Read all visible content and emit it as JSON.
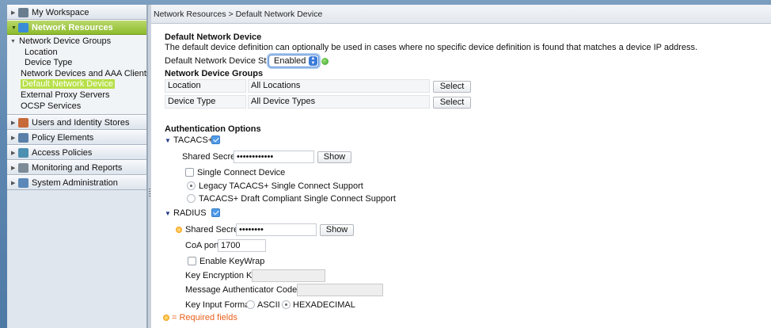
{
  "sidebar": {
    "sections": [
      {
        "label": "My Workspace",
        "icon": "workspace-icon",
        "color": "#6a7d8f"
      },
      {
        "label": "Network Resources",
        "icon": "network-icon",
        "color": "#3a8bd8",
        "active": true
      },
      {
        "label": "Users and Identity Stores",
        "icon": "users-icon",
        "color": "#c66a3a"
      },
      {
        "label": "Policy Elements",
        "icon": "policy-elements-icon",
        "color": "#5a7fa8"
      },
      {
        "label": "Access Policies",
        "icon": "access-policies-icon",
        "color": "#4d8fb0"
      },
      {
        "label": "Monitoring and Reports",
        "icon": "monitoring-icon",
        "color": "#7d8a97"
      },
      {
        "label": "System Administration",
        "icon": "system-admin-icon",
        "color": "#5b88b8"
      }
    ],
    "network_resources_items": {
      "group": "Network Device Groups",
      "group_children": [
        "Location",
        "Device Type"
      ],
      "others": [
        "Network Devices and AAA Clients",
        "Default Network Device",
        "External Proxy Servers",
        "OCSP Services"
      ],
      "selected": "Default Network Device"
    }
  },
  "breadcrumb": "Network Resources > Default Network Device",
  "form": {
    "title": "Default Network Device",
    "description": "The default device definition can optionally be used in cases where no specific device definition is found that matches a device IP address.",
    "status_label": "Default Network Device Status:",
    "status_value": "Enabled",
    "ndg_title": "Network Device Groups",
    "ndg_rows": [
      {
        "name": "Location",
        "value": "All Locations",
        "button": "Select"
      },
      {
        "name": "Device Type",
        "value": "All Device Types",
        "button": "Select"
      }
    ],
    "auth_title": "Authentication Options",
    "tacacs": {
      "label": "TACACS+",
      "checked": true,
      "shared_secret_label": "Shared Secret:",
      "shared_secret_value": "••••••••••••",
      "show_button": "Show",
      "single_connect_label": "Single Connect Device",
      "legacy_label": "Legacy TACACS+ Single Connect Support",
      "draft_label": "TACACS+ Draft Compliant Single Connect Support"
    },
    "radius": {
      "label": "RADIUS",
      "checked": true,
      "shared_secret_label": "Shared Secret:",
      "shared_secret_value": "••••••••",
      "show_button": "Show",
      "coa_label": "CoA port:",
      "coa_value": "1700",
      "keywrap_label": "Enable KeyWrap",
      "kek_label": "Key Encryption Key:",
      "mack_label": "Message Authenticator Code Key:",
      "key_format_label": "Key Input Format",
      "ascii_label": "ASCII",
      "hex_label": "HEXADECIMAL",
      "key_format_selected": "HEXADECIMAL"
    },
    "required_note": "= Required fields",
    "required_color": "#e8601c"
  }
}
